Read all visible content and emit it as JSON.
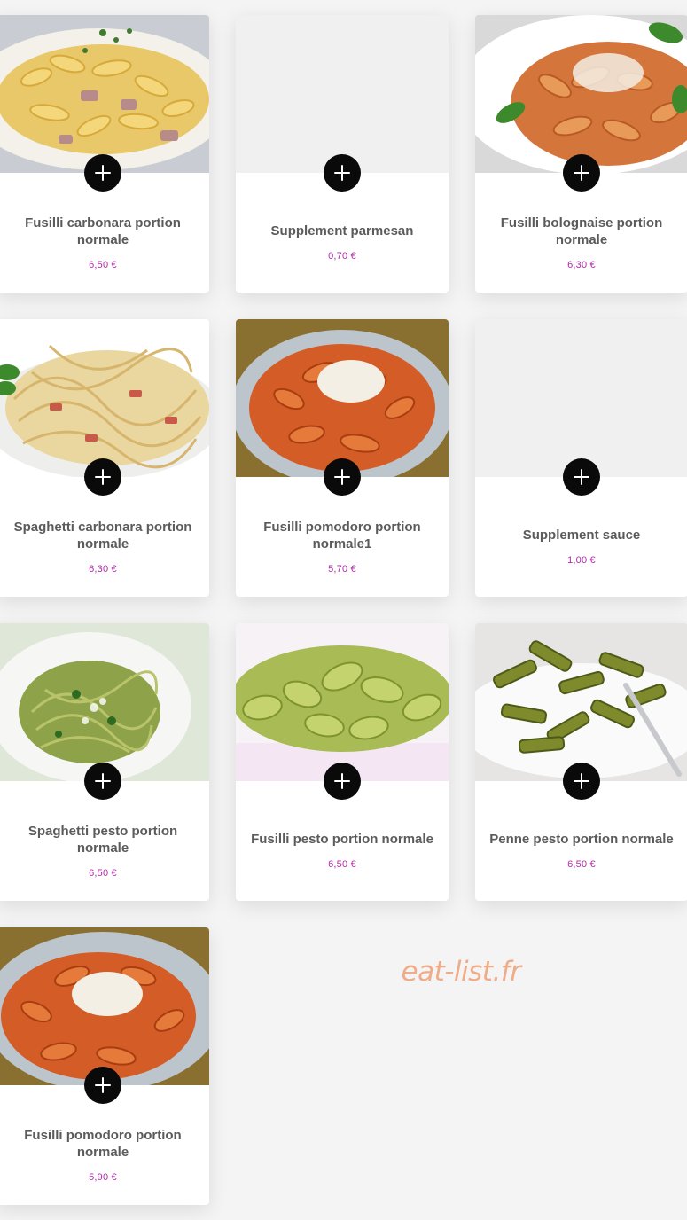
{
  "products": [
    {
      "name": "Fusilli carbonara portion normale",
      "price": "6,50 €",
      "image": "fusilli-carbonara"
    },
    {
      "name": "Supplement parmesan",
      "price": "0,70 €",
      "image": null
    },
    {
      "name": "Fusilli bolognaise portion normale",
      "price": "6,30 €",
      "image": "fusilli-bolognaise"
    },
    {
      "name": "Spaghetti carbonara portion normale",
      "price": "6,30 €",
      "image": "spaghetti-carbonara"
    },
    {
      "name": "Fusilli pomodoro portion normale1",
      "price": "5,70 €",
      "image": "fusilli-pomodoro"
    },
    {
      "name": "Supplement sauce",
      "price": "1,00 €",
      "image": null
    },
    {
      "name": "Spaghetti pesto portion normale",
      "price": "6,50 €",
      "image": "spaghetti-pesto"
    },
    {
      "name": "Fusilli pesto portion normale",
      "price": "6,50 €",
      "image": "fusilli-pesto"
    },
    {
      "name": "Penne pesto portion normale",
      "price": "6,50 €",
      "image": "penne-pesto"
    },
    {
      "name": "Fusilli pomodoro portion normale",
      "price": "5,90 €",
      "image": "fusilli-pomodoro-2"
    }
  ],
  "add_button_icon": "plus-icon",
  "watermark": "eat-list.fr",
  "colors": {
    "price": "#b02ba8",
    "title": "#5b5b5b",
    "button": "#0a0a0a",
    "watermark": "#f0ac86",
    "background": "#f4f4f4"
  }
}
